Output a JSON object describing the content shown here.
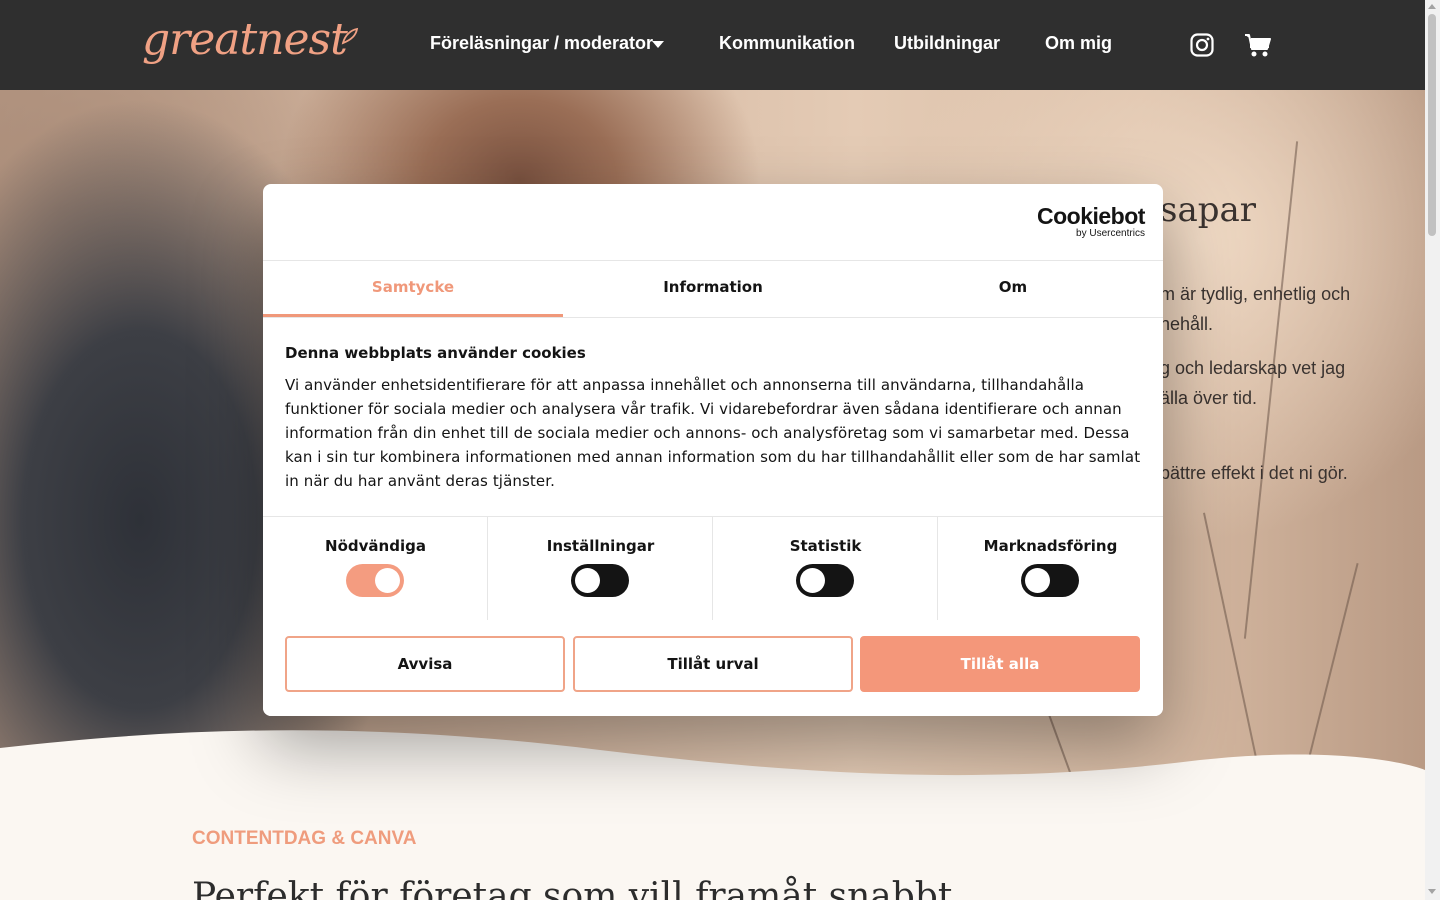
{
  "header": {
    "logo": "greatnest",
    "nav": [
      {
        "label": "Föreläsningar / moderator"
      },
      {
        "label": "Kommunikation"
      },
      {
        "label": "Utbildningar"
      },
      {
        "label": "Om mig"
      }
    ],
    "icons": [
      "instagram-icon",
      "cart-icon",
      "chevron-down-icon"
    ]
  },
  "hero": {
    "title_fragment": "sapar",
    "lines": [
      "m är tydlig, enhetlig och",
      "nehåll.",
      "g och ledarskap vet jag",
      "älla över tid.",
      "bättre effekt i det ni gör."
    ]
  },
  "section": {
    "label": "CONTENTDAG & CANVA",
    "title": "Perfekt för företag som vill framåt snabbt"
  },
  "cookie_dialog": {
    "brand": "Cookiebot",
    "brand_sub": "by Usercentrics",
    "tabs": [
      "Samtycke",
      "Information",
      "Om"
    ],
    "active_tab": "Samtycke",
    "heading": "Denna webbplats använder cookies",
    "body": "Vi använder enhetsidentifierare för att anpassa innehållet och annonserna till användarna, tillhandahålla funktioner för sociala medier och analysera vår trafik. Vi vidarebefordrar även sådana identifierare och annan information från din enhet till de sociala medier och annons- och analysföretag som vi samarbetar med. Dessa kan i sin tur kombinera informationen med annan information som du har tillhandahållit eller som de har samlat in när du har använt deras tjänster.",
    "categories": [
      {
        "label": "Nödvändiga",
        "enabled": true
      },
      {
        "label": "Inställningar",
        "enabled": false
      },
      {
        "label": "Statistik",
        "enabled": false
      },
      {
        "label": "Marknadsföring",
        "enabled": false
      }
    ],
    "buttons": {
      "deny": "Avvisa",
      "allow_selection": "Tillåt urval",
      "allow_all": "Tillåt alla"
    },
    "colors": {
      "accent": "#f4977a",
      "toggle_off": "#141414"
    }
  },
  "colors": {
    "header_bg": "#2f2f2f",
    "brand": "#f0a184",
    "page_bg": "#fbf7f2"
  }
}
